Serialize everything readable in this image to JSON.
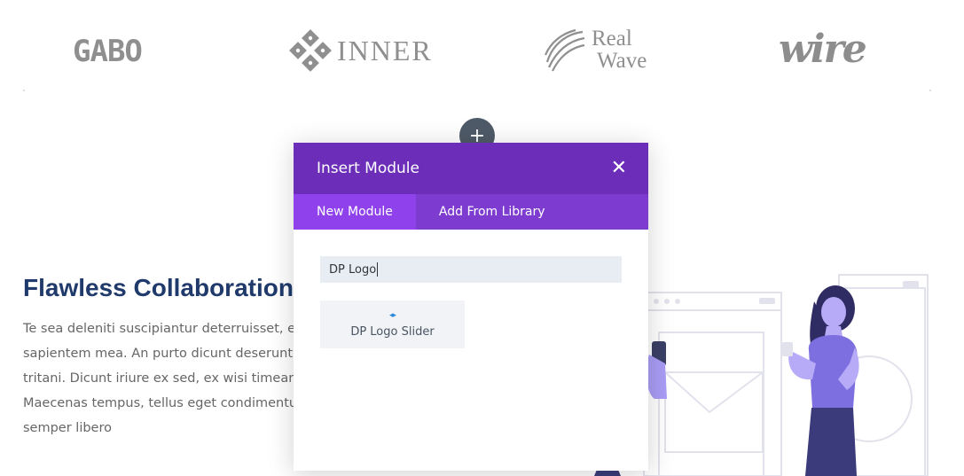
{
  "logos": {
    "gabo": "GABO",
    "inner": "INNER",
    "realwave_line1": "Real",
    "realwave_line2": "Wave",
    "wire": "wire"
  },
  "section": {
    "title": "Flawless Collaboration",
    "body_lines": [
      "Te sea deleniti suscipiantur deterruisset, e",
      "sapientem mea. An purto dicunt deserunt",
      "tritani. Dicunt iriure ex sed, ex wisi timean",
      "Maecenas tempus, tellus eget condimentu",
      "semper libero"
    ]
  },
  "add_button": {
    "label": "+"
  },
  "modal": {
    "title": "Insert Module",
    "close_label": "✕",
    "tabs": [
      {
        "label": "New Module",
        "active": true
      },
      {
        "label": "Add From Library",
        "active": false
      }
    ],
    "search_value": "DP Logo",
    "results": [
      {
        "icon": "◂▸",
        "icon_name": "slider-arrows-icon",
        "label": "DP Logo Slider"
      }
    ]
  },
  "colors": {
    "modal_header": "#6c2eb9",
    "tab_bar": "#7e3bd0",
    "tab_active": "#8f42ec",
    "title_blue": "#1f3a6b",
    "illustration_purple": "#7b68ee"
  }
}
